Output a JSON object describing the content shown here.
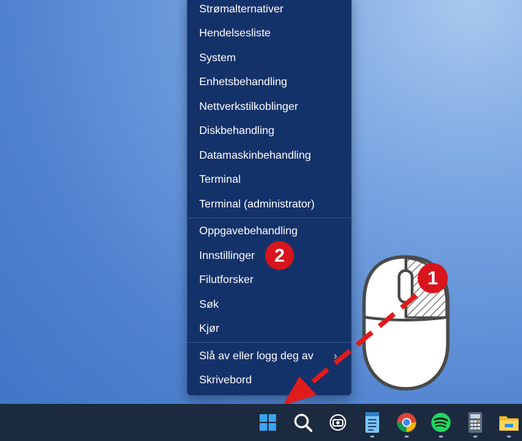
{
  "menu": {
    "items": [
      {
        "label": "Strømalternativer"
      },
      {
        "label": "Hendelsesliste"
      },
      {
        "label": "System"
      },
      {
        "label": "Enhetsbehandling"
      },
      {
        "label": "Nettverkstilkoblinger"
      },
      {
        "label": "Diskbehandling"
      },
      {
        "label": "Datamaskinbehandling"
      },
      {
        "label": "Terminal"
      },
      {
        "label": "Terminal (administrator)"
      },
      {
        "label": "Oppgavebehandling"
      },
      {
        "label": "Innstillinger"
      },
      {
        "label": "Filutforsker"
      },
      {
        "label": "Søk"
      },
      {
        "label": "Kjør"
      },
      {
        "label": "Slå av eller logg deg av"
      },
      {
        "label": "Skrivebord"
      }
    ],
    "submenu_arrow": "›"
  },
  "badges": {
    "one": "1",
    "two": "2"
  },
  "taskbar": {
    "icons": [
      "windows-start-icon",
      "search-icon",
      "copilot-icon",
      "notepad-icon",
      "chrome-icon",
      "spotify-icon",
      "calculator-icon",
      "file-explorer-icon"
    ]
  },
  "colors": {
    "menu_bg": "#14326a",
    "badge_red": "#d8141c",
    "arrow_red": "#e01b1b",
    "taskbar_bg": "#1c2a3f"
  }
}
